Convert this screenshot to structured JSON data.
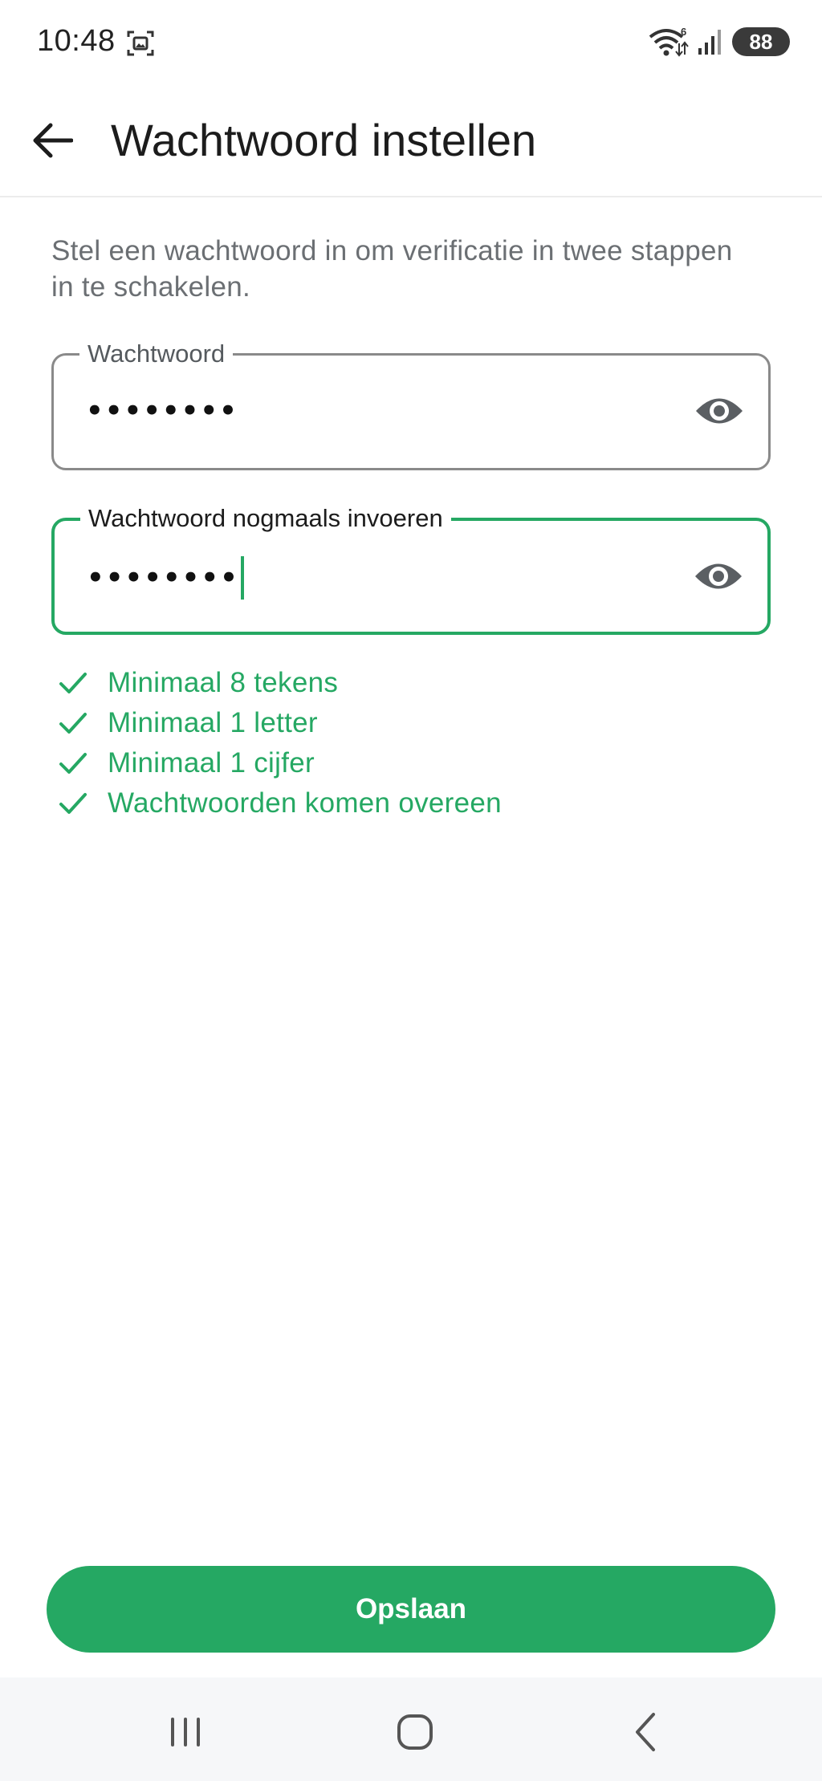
{
  "status_bar": {
    "time": "10:48",
    "battery": "88",
    "wifi_badge": "6"
  },
  "app_bar": {
    "title": "Wachtwoord instellen"
  },
  "intro_text": "Stel een wachtwoord in om verificatie in twee stappen in te schakelen.",
  "password_field": {
    "label": "Wachtwoord",
    "value": "••••••••"
  },
  "confirm_field": {
    "label": "Wachtwoord nogmaals invoeren",
    "value": "••••••••"
  },
  "rules": [
    {
      "label": "Minimaal 8 tekens",
      "met": true
    },
    {
      "label": "Minimaal 1 letter",
      "met": true
    },
    {
      "label": "Minimaal 1 cijfer",
      "met": true
    },
    {
      "label": "Wachtwoorden komen overeen",
      "met": true
    }
  ],
  "save_button": {
    "label": "Opslaan"
  },
  "colors": {
    "accent": "#25a863",
    "field_border": "#8a8a8a",
    "nav_bar": "#f6f7f9"
  },
  "icons": {
    "back": "arrow-left-icon",
    "visibility": "eye-icon",
    "check": "check-icon",
    "nav_recents": "recents-icon",
    "nav_home": "home-icon",
    "nav_back": "chevron-left-icon"
  }
}
